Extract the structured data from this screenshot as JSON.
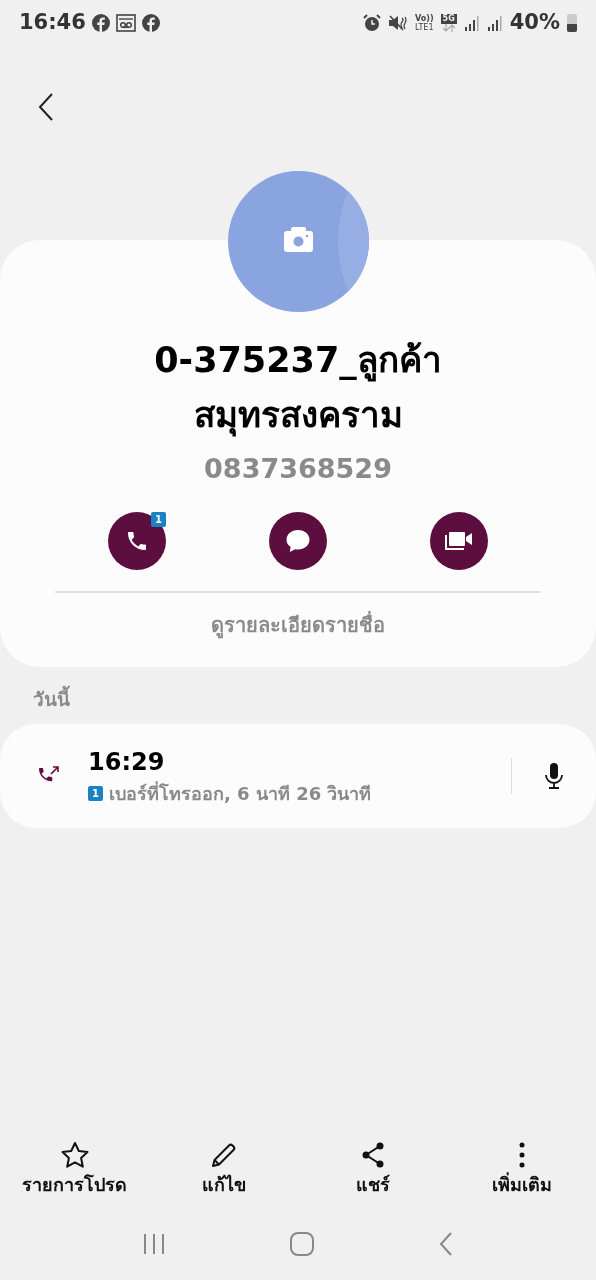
{
  "status_bar": {
    "time": "16:46",
    "volte": "Vo))",
    "lte": "LTE1",
    "network": "5G",
    "battery": "40%"
  },
  "contact": {
    "name_lines": [
      "0-375237_ลูกค้า",
      "สมุทรสงคราม"
    ],
    "phone": "0837368529",
    "actions": [
      {
        "kind": "call",
        "badge": "1"
      },
      {
        "kind": "message"
      },
      {
        "kind": "video"
      }
    ],
    "details_link": "ดูรายละเอียดรายชื่อ"
  },
  "history": {
    "section": "วันนี้",
    "entries": [
      {
        "time": "16:29",
        "sim": "1",
        "description": "เบอร์ที่โทรออก, 6 นาที 26 วินาที"
      }
    ]
  },
  "bottom_bar": [
    {
      "kind": "star",
      "label": "รายการโปรด"
    },
    {
      "kind": "edit",
      "label": "แก้ไข"
    },
    {
      "kind": "share",
      "label": "แชร์"
    },
    {
      "kind": "more",
      "label": "เพิ่มเติม"
    }
  ]
}
